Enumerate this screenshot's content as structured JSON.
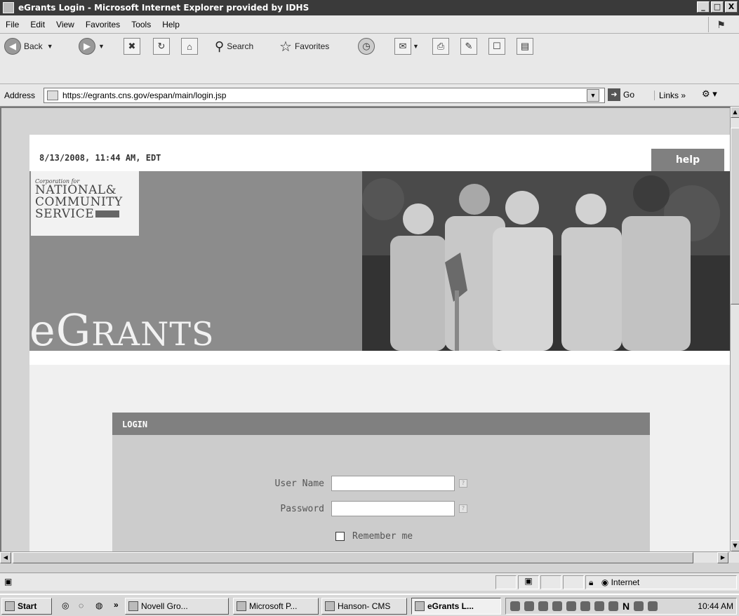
{
  "window": {
    "title": "eGrants Login - Microsoft Internet Explorer provided by IDHS",
    "controls": [
      "_",
      "□",
      "X"
    ]
  },
  "menu": [
    "File",
    "Edit",
    "View",
    "Favorites",
    "Tools",
    "Help"
  ],
  "toolbar": {
    "back_label": "Back",
    "search_label": "Search",
    "favorites_label": "Favorites"
  },
  "address": {
    "label": "Address",
    "url": "https://egrants.cns.gov/espan/main/login.jsp",
    "go_label": "Go",
    "links_label": "Links »"
  },
  "page": {
    "datetime": "8/13/2008, 11:44 AM, EDT",
    "help_label": "help",
    "logo": {
      "corp": "Corporation for",
      "line1": "NATIONAL&",
      "line2": "COMMUNITY",
      "line3": "SERVICE"
    },
    "brand_first": "e",
    "brand_big": "G",
    "brand_rest": "RANTS",
    "login": {
      "heading": "LOGIN",
      "username_label": "User Name",
      "password_label": "Password",
      "remember_label": "Remember me",
      "username_value": "",
      "password_value": ""
    }
  },
  "statusbar": {
    "zone": "Internet"
  },
  "taskbar": {
    "start": "Start",
    "more": "»",
    "tasks": [
      "Novell Gro...",
      "Microsoft P...",
      "Hanson- CMS",
      "eGrants L..."
    ],
    "clock": "10:44 AM"
  }
}
